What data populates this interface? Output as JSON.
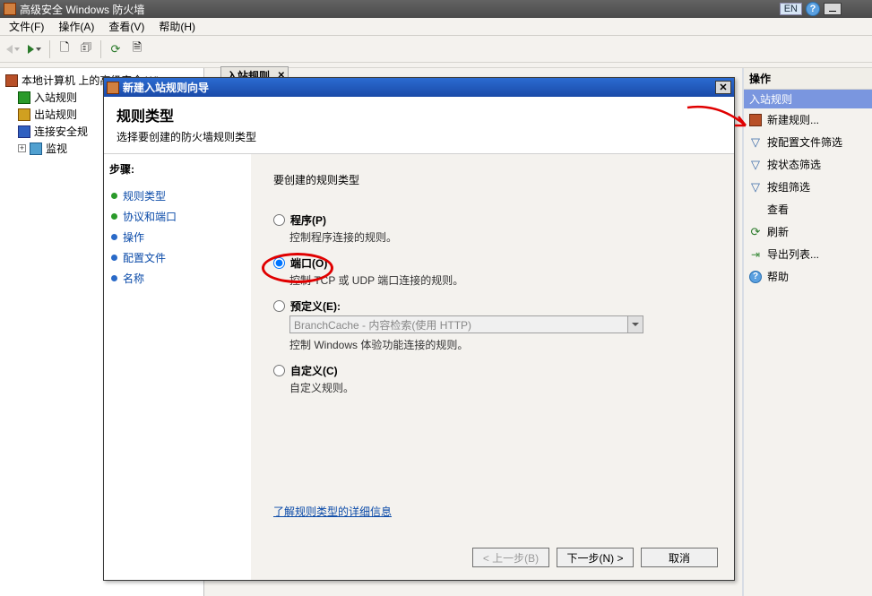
{
  "window": {
    "title": "高级安全 Windows 防火墙",
    "lang_badge": "EN"
  },
  "menu": {
    "file": "文件(F)",
    "action": "操作(A)",
    "view": "查看(V)",
    "help": "帮助(H)"
  },
  "tree": {
    "root": "本地计算机 上的高级安全 Win",
    "inbound": "入站规则",
    "outbound": "出站规则",
    "connsec": "连接安全规",
    "monitor": "监视"
  },
  "center_tab": "入站规则",
  "actions": {
    "header": "操作",
    "section": "入站规则",
    "new_rule": "新建规则...",
    "filter_profile": "按配置文件筛选",
    "filter_state": "按状态筛选",
    "filter_group": "按组筛选",
    "view": "查看",
    "refresh": "刷新",
    "export": "导出列表...",
    "help": "帮助"
  },
  "wizard": {
    "title": "新建入站规则向导",
    "header": "规则类型",
    "subheader": "选择要创建的防火墙规则类型",
    "steps_label": "步骤:",
    "steps": {
      "s1": "规则类型",
      "s2": "协议和端口",
      "s3": "操作",
      "s4": "配置文件",
      "s5": "名称"
    },
    "question": "要创建的规则类型",
    "opt_program": "程序(P)",
    "opt_program_desc": "控制程序连接的规则。",
    "opt_port": "端口(O)",
    "opt_port_desc": "控制 TCP 或 UDP 端口连接的规则。",
    "opt_predef": "预定义(E):",
    "opt_predef_value": "BranchCache - 内容检索(使用 HTTP)",
    "opt_predef_desc": "控制 Windows 体验功能连接的规则。",
    "opt_custom": "自定义(C)",
    "opt_custom_desc": "自定义规则。",
    "learn_more": "了解规则类型的详细信息",
    "btn_back": "< 上一步(B)",
    "btn_next": "下一步(N) >",
    "btn_cancel": "取消"
  }
}
